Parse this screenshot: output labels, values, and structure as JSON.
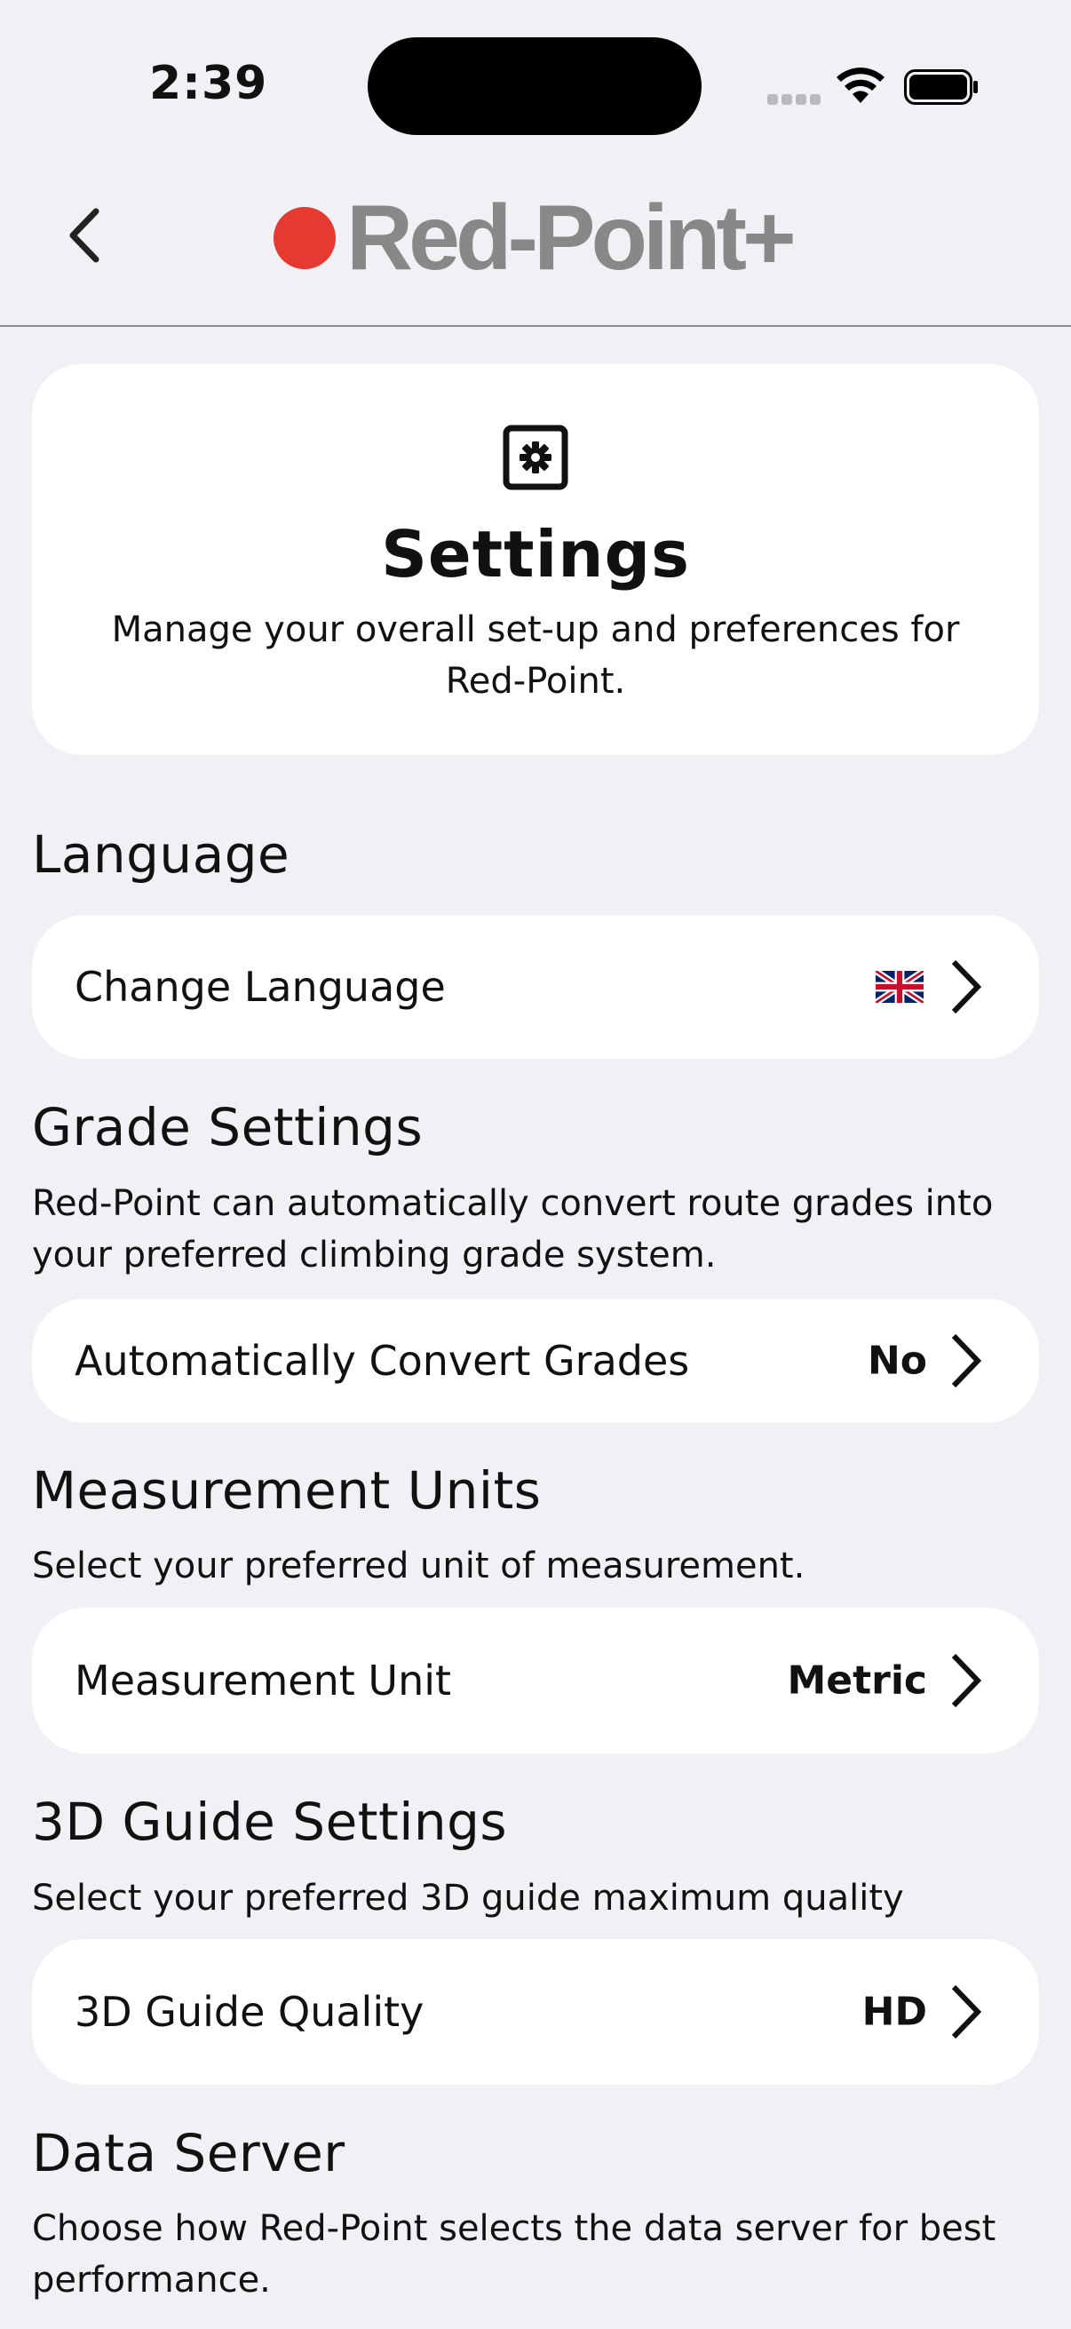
{
  "status_bar": {
    "time": "2:39"
  },
  "header": {
    "brand": "Red-Point+",
    "brand_color": "#e53a32"
  },
  "settings_card": {
    "icon": "gear-box-icon",
    "title": "Settings",
    "description": "Manage your overall set-up and preferences for Red-Point."
  },
  "sections": {
    "language": {
      "title": "Language",
      "row_label": "Change Language",
      "row_icon": "uk-flag-icon"
    },
    "grade": {
      "title": "Grade Settings",
      "description": "Red-Point can automatically convert route grades into your preferred climbing grade system.",
      "row_label": "Automatically Convert Grades",
      "row_value": "No"
    },
    "measurement": {
      "title": "Measurement Units",
      "description": "Select your preferred unit of measurement.",
      "row_label": "Measurement Unit",
      "row_value": "Metric"
    },
    "guide3d": {
      "title": "3D Guide Settings",
      "description": "Select your preferred 3D guide maximum quality",
      "row_label": "3D Guide Quality",
      "row_value": "HD"
    },
    "server": {
      "title": "Data Server",
      "description": "Choose how Red-Point selects the data server for best performance."
    }
  }
}
